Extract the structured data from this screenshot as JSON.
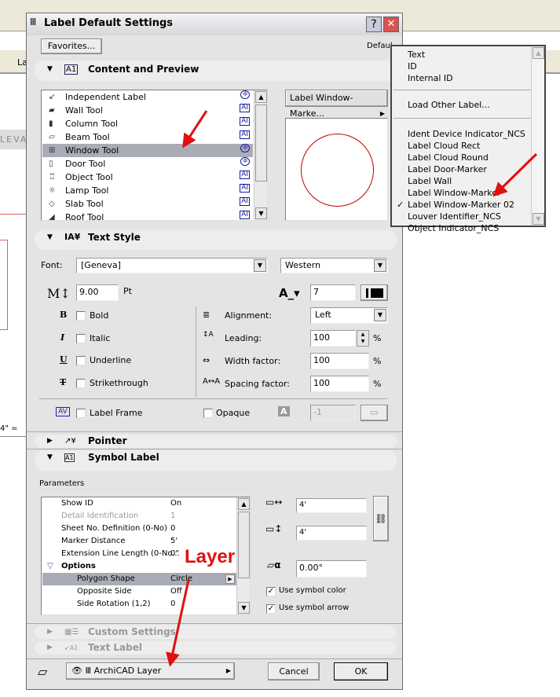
{
  "background": {
    "left_tab": "LEVA",
    "scale_text": "4\" =",
    "toolbar_partial_label": "La"
  },
  "dialog": {
    "title": "Label Default Settings",
    "help_label": "?",
    "close_label": "✕",
    "favorites": "Favorites...",
    "default_text": "Defaul",
    "content_preview": {
      "header": "Content and Preview",
      "tools": [
        {
          "label": "Independent Label",
          "icon": "independent-label-icon",
          "status": "symbol"
        },
        {
          "label": "Wall Tool",
          "icon": "wall-icon",
          "status": "text"
        },
        {
          "label": "Column Tool",
          "icon": "column-icon",
          "status": "text"
        },
        {
          "label": "Beam Tool",
          "icon": "beam-icon",
          "status": "text"
        },
        {
          "label": "Window Tool",
          "icon": "window-icon",
          "status": "symbol",
          "selected": true
        },
        {
          "label": "Door Tool",
          "icon": "door-icon",
          "status": "symbol"
        },
        {
          "label": "Object Tool",
          "icon": "object-icon",
          "status": "text"
        },
        {
          "label": "Lamp Tool",
          "icon": "lamp-icon",
          "status": "text"
        },
        {
          "label": "Slab Tool",
          "icon": "slab-icon",
          "status": "text"
        },
        {
          "label": "Roof Tool",
          "icon": "roof-icon",
          "status": "text"
        }
      ],
      "label_type_button": "Label Window-Marke...",
      "preview_color": "#c00000"
    },
    "text_style": {
      "header": "Text Style",
      "font_label": "Font:",
      "font": "[Geneva]",
      "script": "Western",
      "size": "9.00",
      "size_unit": "Pt",
      "pen": "7",
      "bold": "Bold",
      "italic": "Italic",
      "underline": "Underline",
      "strikethrough": "Strikethrough",
      "alignment_label": "Alignment:",
      "alignment": "Left",
      "leading_label": "Leading:",
      "leading": "100",
      "width_label": "Width factor:",
      "width": "100",
      "spacing_label": "Spacing factor:",
      "spacing": "100",
      "percent": "%",
      "label_frame": "Label Frame",
      "opaque": "Opaque",
      "fill_pen": "-1",
      "frame_icon_text": "AV"
    },
    "pointer": {
      "header": "Pointer"
    },
    "symbol_label": {
      "header": "Symbol Label",
      "parameters_label": "Parameters",
      "params": [
        {
          "name": "Show ID",
          "value": "On"
        },
        {
          "name": "Detail Identification",
          "value": "1",
          "disabled": true
        },
        {
          "name": "Sheet No. Definition (0-No)",
          "value": "0"
        },
        {
          "name": "Marker Distance",
          "value": "5'"
        },
        {
          "name": "Extension Line Length (0-No...",
          "value": "0\""
        },
        {
          "name": "Options",
          "value": "",
          "group": true
        },
        {
          "name": "Polygon Shape",
          "value": "Circle",
          "selected": true
        },
        {
          "name": "Opposite Side",
          "value": "Off"
        },
        {
          "name": "Side Rotation (1,2)",
          "value": "0"
        }
      ],
      "width": "4'",
      "height": "4'",
      "angle": "0.00°",
      "use_symbol_color": "Use symbol color",
      "use_symbol_arrow": "Use symbol arrow",
      "use_symbol_color_checked": true,
      "use_symbol_arrow_checked": true
    },
    "custom_settings": {
      "header": "Custom Settings"
    },
    "text_label": {
      "header": "Text Label"
    },
    "layer": "ArchiCAD Layer",
    "cancel": "Cancel",
    "ok": "OK"
  },
  "menu": {
    "items_top": [
      "Text",
      "ID",
      "Internal ID"
    ],
    "load_other": "Load Other Label...",
    "labels": [
      "Ident Device Indicator_NCS",
      "Label Cloud Rect",
      "Label Cloud Round",
      "Label Door-Marker",
      "Label Wall",
      "Label Window-Marker",
      "Label Window-Marker 02",
      "Louver Identifier_NCS",
      "Object Indicator_NCS"
    ],
    "checked": "Label Window-Marker 02",
    "check_mark": "✓"
  },
  "annotation": {
    "text": "Layer",
    "color": "#e01010"
  }
}
